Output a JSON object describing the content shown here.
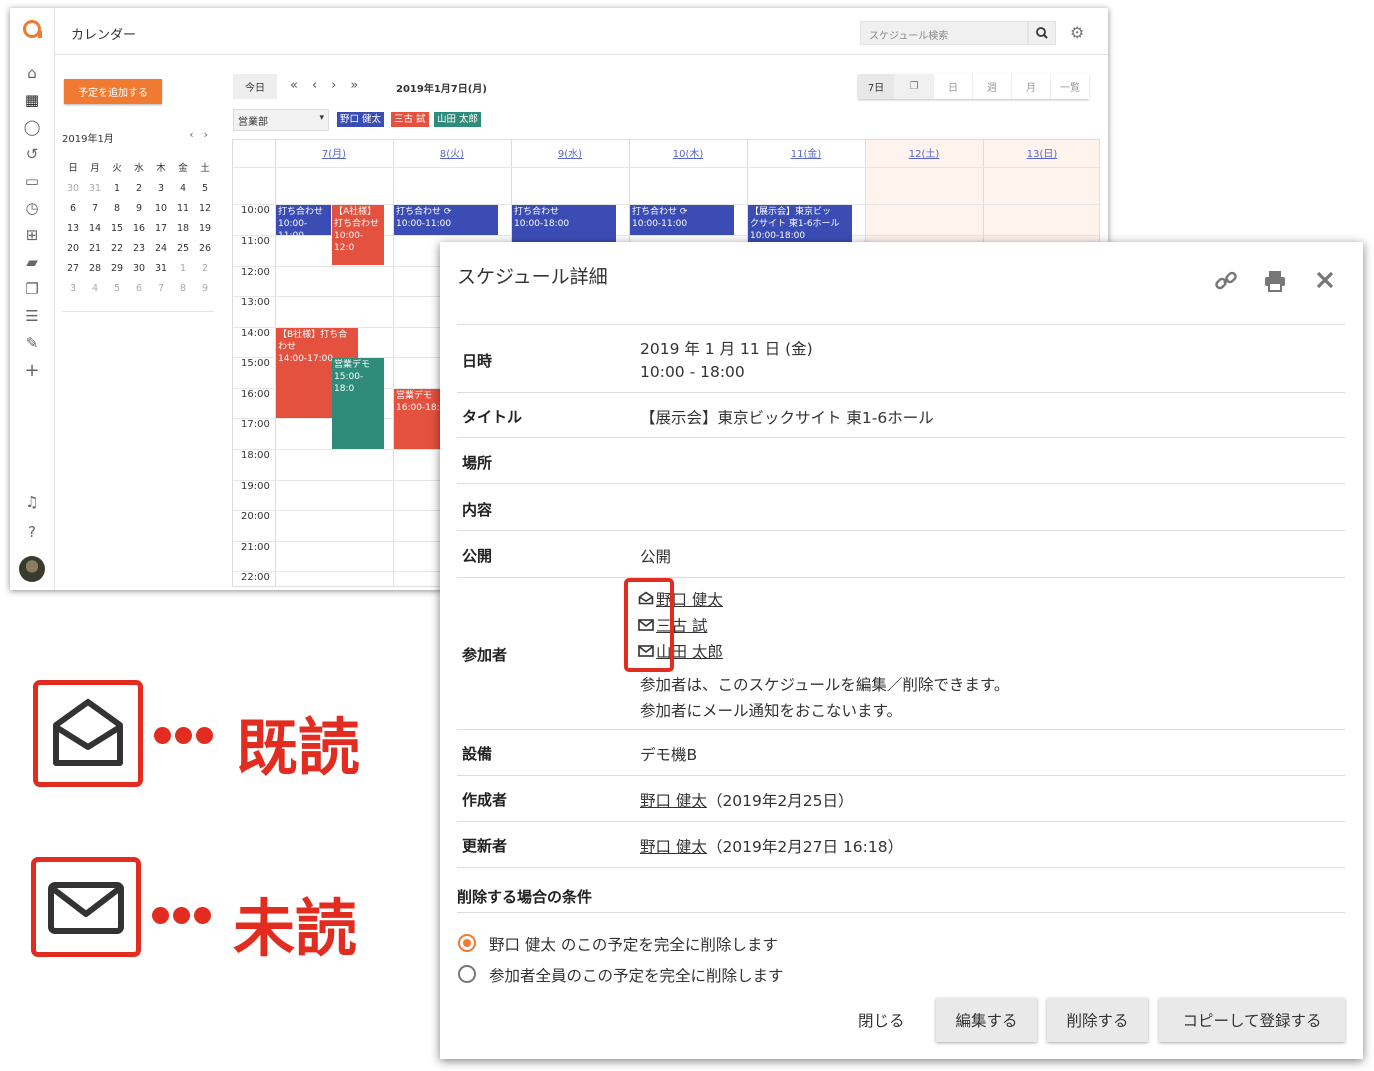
{
  "app": {
    "title": "カレンダー",
    "search_placeholder": "スケジュール検索"
  },
  "sidebar_icons": [
    "home-icon",
    "calendar-icon",
    "chat-icon",
    "history-icon",
    "clipboard-icon",
    "clock-icon",
    "org-chart-icon",
    "folder-icon",
    "copy-icon",
    "checklist-icon",
    "edit-icon",
    "plus-icon",
    "bell-icon",
    "help-icon"
  ],
  "add_button": "予定を追加する",
  "mini_calendar": {
    "title": "2019年1月",
    "weekdays": [
      "日",
      "月",
      "火",
      "水",
      "木",
      "金",
      "土"
    ],
    "days": [
      "30",
      "31",
      "1",
      "2",
      "3",
      "4",
      "5",
      "6",
      "7",
      "8",
      "9",
      "10",
      "11",
      "12",
      "13",
      "14",
      "15",
      "16",
      "17",
      "18",
      "19",
      "20",
      "21",
      "22",
      "23",
      "24",
      "25",
      "26",
      "27",
      "28",
      "29",
      "30",
      "31",
      "1",
      "2",
      "3",
      "4",
      "5",
      "6",
      "7",
      "8",
      "9"
    ]
  },
  "toolbar": {
    "today": "今日",
    "current_date": "2019年1月7日(月)",
    "views": [
      "7日",
      "日",
      "週",
      "月",
      "一覧"
    ],
    "department": "営業部",
    "members": [
      {
        "name": "野口 健太",
        "color": "#3b4db5"
      },
      {
        "name": "三古 試",
        "color": "#e4513f"
      },
      {
        "name": "山田 太郎",
        "color": "#2f8c7a"
      }
    ]
  },
  "calendar": {
    "days": [
      "7(月)",
      "8(火)",
      "9(水)",
      "10(木)",
      "11(金)",
      "12(土)",
      "13(日)"
    ],
    "hours": [
      "10:00",
      "11:00",
      "12:00",
      "13:00",
      "14:00",
      "15:00",
      "16:00",
      "17:00",
      "18:00",
      "19:00",
      "20:00",
      "21:00",
      "22:00"
    ],
    "events": [
      {
        "text": "打ち合わせ\n10:00-11:00"
      },
      {
        "text": "【A社様】\n打ち合わせ\n10:00-12:0"
      },
      {
        "text": "打ち合わせ ⟳\n10:00-11:00"
      },
      {
        "text": "打ち合わせ\n10:00-18:00"
      },
      {
        "text": "打ち合わせ ⟳\n10:00-11:00"
      },
      {
        "text": "【展示会】東京ビッ\nクサイト 東1-6ホール\n10:00-18:00"
      },
      {
        "text": "【B社様】打ち合\nわせ\n14:00-17:00"
      },
      {
        "text": "営業デモ\n15:00-18:0"
      },
      {
        "text": "営業デモ\n16:00-18:"
      }
    ]
  },
  "modal": {
    "title": "スケジュール詳細",
    "rows": {
      "datetime_label": "日時",
      "datetime_date": "2019 年 1 月 11 日 (金)",
      "datetime_time": "10:00 - 18:00",
      "title_label": "タイトル",
      "title_value": "【展示会】東京ビックサイト 東1-6ホール",
      "place_label": "場所",
      "content_label": "内容",
      "public_label": "公開",
      "public_value": "公開",
      "participants_label": "参加者",
      "participants": [
        {
          "name": "野口 健太",
          "status": "read"
        },
        {
          "name": "三古 試",
          "status": "unread"
        },
        {
          "name": "山田 太郎",
          "status": "unread"
        }
      ],
      "participants_note1": "参加者は、このスケジュールを編集／削除できます。",
      "participants_note2": "参加者にメール通知をおこないます。",
      "equipment_label": "設備",
      "equipment_value": "デモ機B",
      "creator_label": "作成者",
      "creator_name": "野口 健太",
      "creator_date": "（2019年2月25日）",
      "updater_label": "更新者",
      "updater_name": "野口 健太",
      "updater_date": "（2019年2月27日 16:18）"
    },
    "delete_section": "削除する場合の条件",
    "delete_options": [
      "野口 健太 のこの予定を完全に削除します",
      "参加者全員のこの予定を完全に削除します"
    ],
    "buttons": {
      "close": "閉じる",
      "edit": "編集する",
      "delete": "削除する",
      "copy": "コピーして登録する"
    }
  },
  "legend": {
    "read": "既読",
    "unread": "未読"
  },
  "accent_color": "#f07a31",
  "highlight_color": "#e32c20"
}
